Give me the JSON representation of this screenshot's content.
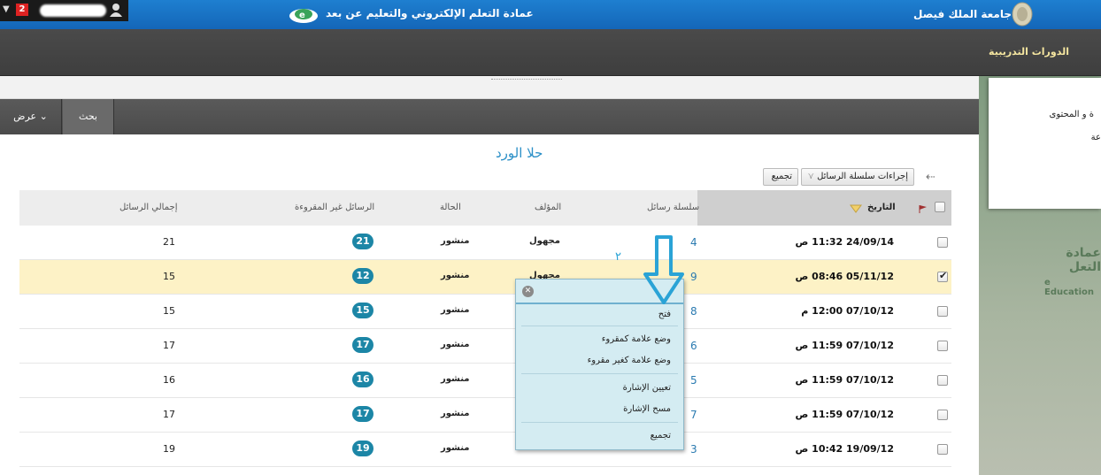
{
  "banner": {
    "notification_count": "2",
    "dean_title": "عمادة التعلم الإلكتروني والتعليم عن بعد",
    "university_name": "جامعة الملك فيصل"
  },
  "nav": {
    "tab_label": "الدورات التدريبية"
  },
  "toolbar": {
    "view_label": "عرض",
    "search_label": "بحث"
  },
  "side": {
    "line1": "ة و المحتوى",
    "line2": "عة",
    "brand_ar": "عمادة التعل",
    "brand_en": "e Education"
  },
  "forum": {
    "title": "حلا الورد",
    "collect_label": "تجميع",
    "thread_actions_label": "إجراءات سلسلة الرسائل"
  },
  "table": {
    "headers": {
      "date": "التاريخ",
      "thread": "سلسلة رسائل",
      "author": "المؤلف",
      "status": "الحالة",
      "unread": "الرسائل غير المقروءة",
      "total": "إجمالي الرسائل"
    },
    "rows": [
      {
        "date": "24/09/14 11:32 ص",
        "thread": "4",
        "author": "مجهول",
        "status": "منشور",
        "unread": "21",
        "total": "21",
        "checked": false
      },
      {
        "date": "05/11/12 08:46 ص",
        "thread": "9",
        "author": "مجهول",
        "status": "منشور",
        "unread": "12",
        "total": "15",
        "checked": true
      },
      {
        "date": "07/10/12 12:00 م",
        "thread": "8",
        "author": "",
        "status": "منشور",
        "unread": "15",
        "total": "15",
        "checked": false
      },
      {
        "date": "07/10/12 11:59 ص",
        "thread": "6",
        "author": "",
        "status": "منشور",
        "unread": "17",
        "total": "17",
        "checked": false
      },
      {
        "date": "07/10/12 11:59 ص",
        "thread": "5",
        "author": "",
        "status": "منشور",
        "unread": "16",
        "total": "16",
        "checked": false
      },
      {
        "date": "07/10/12 11:59 ص",
        "thread": "7",
        "author": "",
        "status": "منشور",
        "unread": "17",
        "total": "17",
        "checked": false
      },
      {
        "date": "19/09/12 10:42 ص",
        "thread": "3",
        "author": "",
        "status": "منشور",
        "unread": "19",
        "total": "19",
        "checked": false
      }
    ]
  },
  "context_menu": {
    "open": "فتح",
    "mark_read": "وضع علامة كمقروء",
    "mark_unread": "وضع علامة كغير مقروء",
    "set_flag": "تعيين الإشارة",
    "clear_flag": "مسح الإشارة",
    "collect": "تجميع"
  },
  "annotation": {
    "number": "٢"
  }
}
